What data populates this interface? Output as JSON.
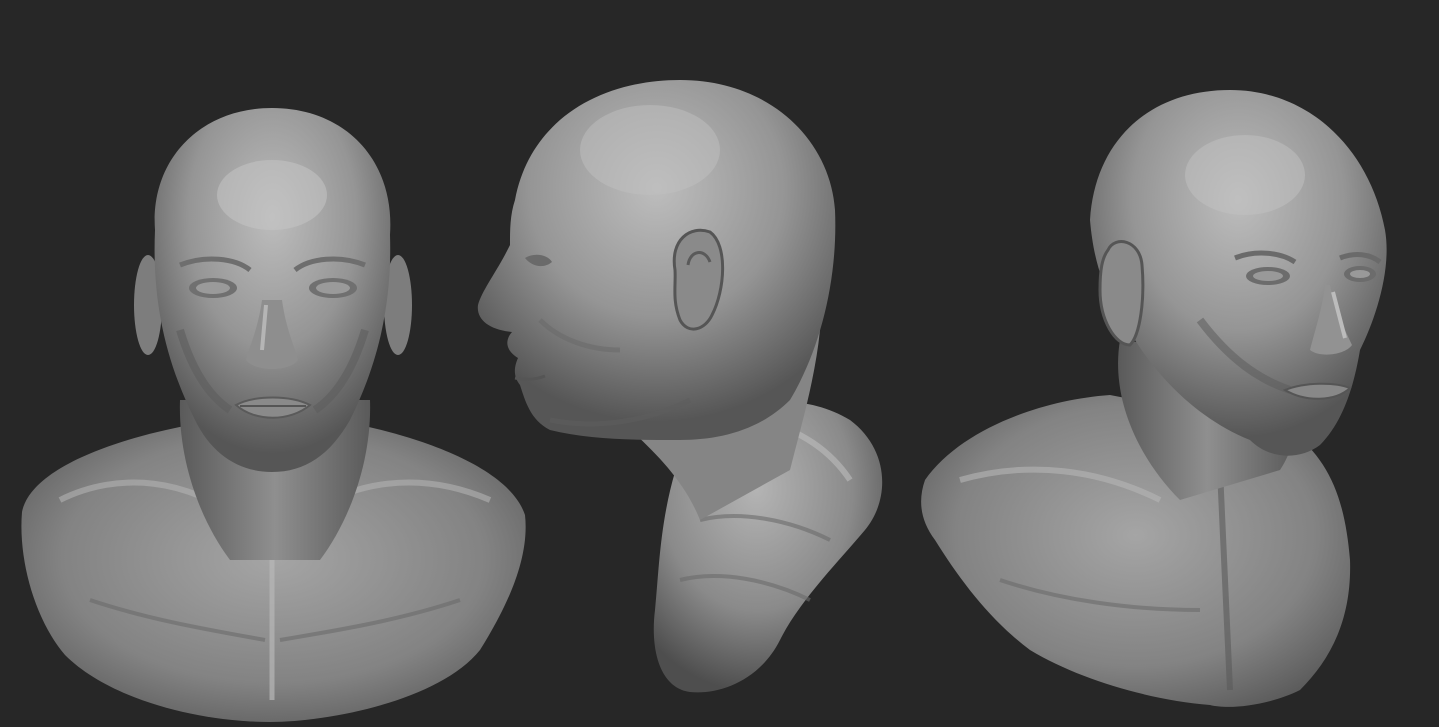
{
  "viewport": {
    "background_color": "#272727",
    "material_color": "#8c8c8c",
    "highlight_color": "#c8c8c8",
    "shadow_color": "#2e2e2e"
  },
  "bust_views": [
    {
      "view": "front"
    },
    {
      "view": "profile-left"
    },
    {
      "view": "three-quarter-right"
    }
  ]
}
